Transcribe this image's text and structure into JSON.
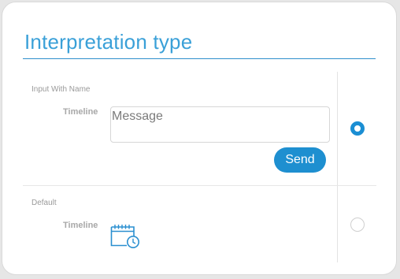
{
  "title": "Interpretation type",
  "options": [
    {
      "section_label": "Input With Name",
      "field_label": "Timeline",
      "input_placeholder": "Message",
      "input_value": "",
      "button_label": "Send",
      "selected": true
    },
    {
      "section_label": "Default",
      "field_label": "Timeline",
      "icon": "calendar-clock-icon",
      "selected": false
    }
  ],
  "colors": {
    "accent": "#1a8ed3",
    "title": "#3aa0d8",
    "label": "#a8a8a8"
  }
}
